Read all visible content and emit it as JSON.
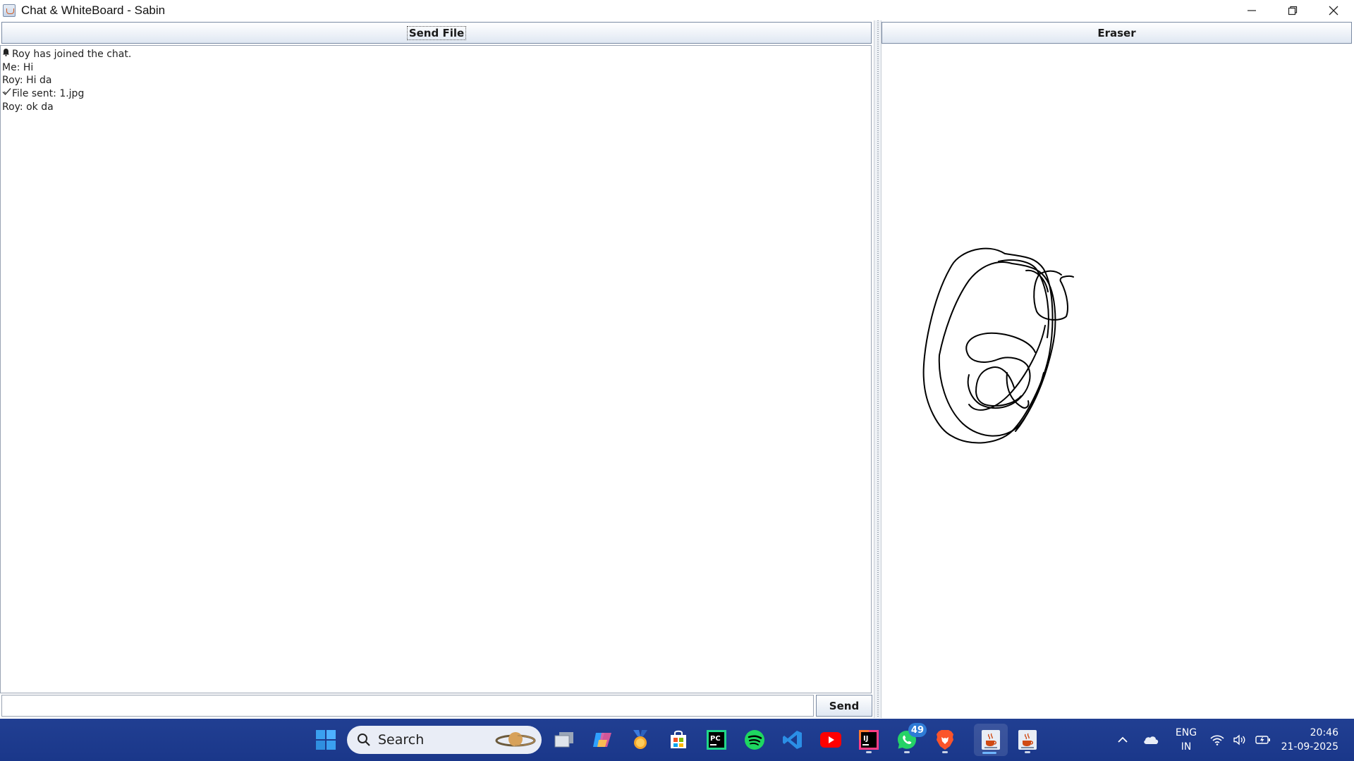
{
  "window": {
    "title": "Chat & WhiteBoard - Sabin",
    "minimize_icon": "minimize-icon",
    "maximize_icon": "restore-icon",
    "close_icon": "close-icon"
  },
  "chat": {
    "send_file_label": "Send File",
    "messages": [
      {
        "icon": "bell-icon",
        "text": "Roy has joined the chat."
      },
      {
        "icon": "",
        "text": "Me: Hi"
      },
      {
        "icon": "",
        "text": "Roy: Hi da"
      },
      {
        "icon": "checkmark-icon",
        "text": "File sent: 1.jpg"
      },
      {
        "icon": "",
        "text": "Roy: ok da"
      }
    ],
    "input_value": "",
    "send_label": "Send"
  },
  "whiteboard": {
    "eraser_label": "Eraser",
    "stroke_color": "#000000"
  },
  "taskbar": {
    "search_label": "Search",
    "apps": [
      {
        "name": "start-button",
        "icon": "windows-logo-icon"
      },
      {
        "name": "task-view",
        "icon": "task-view-icon"
      },
      {
        "name": "copilot",
        "icon": "copilot-icon"
      },
      {
        "name": "rewards",
        "icon": "medal-icon"
      },
      {
        "name": "microsoft-store",
        "icon": "store-icon"
      },
      {
        "name": "pycharm",
        "icon": "pycharm-icon"
      },
      {
        "name": "spotify",
        "icon": "spotify-icon"
      },
      {
        "name": "vscode",
        "icon": "vscode-icon"
      },
      {
        "name": "youtube",
        "icon": "youtube-icon"
      },
      {
        "name": "intellij",
        "icon": "intellij-icon"
      },
      {
        "name": "whatsapp",
        "icon": "whatsapp-icon"
      },
      {
        "name": "brave",
        "icon": "brave-icon"
      },
      {
        "name": "java-app-1",
        "icon": "java-icon"
      },
      {
        "name": "java-app-2",
        "icon": "java-icon"
      }
    ],
    "whatsapp_badge": "49",
    "lang_line1": "ENG",
    "lang_line2": "IN",
    "time": "20:46",
    "date": "21-09-2025"
  }
}
